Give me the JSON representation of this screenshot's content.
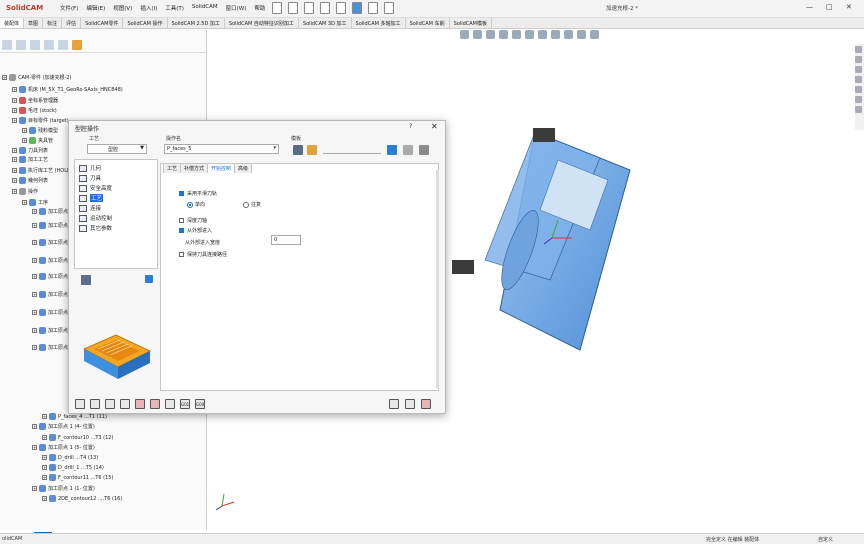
{
  "app": {
    "logo": "SolidCAM",
    "menus": [
      "文件(F)",
      "编辑(E)",
      "视图(V)",
      "插入(I)",
      "工具(T)",
      "SolidCAM",
      "窗口(W)",
      "帮助"
    ],
    "window_title": "加速充根-2 *"
  },
  "tabs": [
    "装配体",
    "草图",
    "标注",
    "评估",
    "SolidCAM零件",
    "SolidCAM 操作",
    "SolidCAM 2.5D 加工",
    "SolidCAM 自动特征识别加工",
    "SolidCAM 3D 加工",
    "SolidCAM 多轴加工",
    "SolidCAM 车削",
    "SolidCAM模板"
  ],
  "tree": {
    "items": [
      {
        "text": "CAM-零件 (加速充根-2)",
        "indent": 0,
        "icon": "gray"
      },
      {
        "text": "机床 (M_5X_T1_GeoRo SAxis_HNC848)",
        "indent": 1,
        "icon": "blue"
      },
      {
        "text": "坐标系管理器",
        "indent": 1,
        "icon": "red"
      },
      {
        "text": "毛坯 (stock)",
        "indent": 1,
        "icon": "red"
      },
      {
        "text": "目标零件 (target)",
        "indent": 1,
        "icon": "blue"
      },
      {
        "text": "残料模型",
        "indent": 2,
        "icon": "blue"
      },
      {
        "text": "夹具管",
        "indent": 2,
        "icon": "green"
      },
      {
        "text": "刀具列表",
        "indent": 1,
        "icon": "blue"
      },
      {
        "text": "加工工艺",
        "indent": 1,
        "icon": "blue"
      },
      {
        "text": "执行库工艺 (HOLE",
        "indent": 1,
        "icon": "blue"
      },
      {
        "text": "幾何列表",
        "indent": 1,
        "icon": "blue"
      },
      {
        "text": "操作",
        "indent": 1,
        "icon": "gray"
      },
      {
        "text": "工序",
        "indent": 2,
        "icon": "blue"
      },
      {
        "text": "加工原点",
        "indent": 3,
        "icon": "blue"
      },
      {
        "text": "加工原点",
        "indent": 3,
        "icon": "blue"
      },
      {
        "text": "加工原点",
        "indent": 3,
        "icon": "blue"
      },
      {
        "text": "加工原点",
        "indent": 3,
        "icon": "blue"
      },
      {
        "text": "加工原点",
        "indent": 3,
        "icon": "blue"
      },
      {
        "text": "加工原点",
        "indent": 3,
        "icon": "blue"
      },
      {
        "text": "加工原点",
        "indent": 3,
        "icon": "blue"
      },
      {
        "text": "加工原点",
        "indent": 3,
        "icon": "blue"
      },
      {
        "text": "加工原点",
        "indent": 3,
        "icon": "blue"
      },
      {
        "text": "P_faces_4 ...T1 (11)",
        "indent": 4,
        "icon": "blue"
      },
      {
        "text": "加工原点 1 (4- 位置)",
        "indent": 3,
        "icon": "blue"
      },
      {
        "text": "F_contour10 ...T3 (12)",
        "indent": 4,
        "icon": "blue"
      },
      {
        "text": "加工原点 1 (5- 位置)",
        "indent": 3,
        "icon": "blue"
      },
      {
        "text": "D_drill ...T4 (13)",
        "indent": 4,
        "icon": "blue"
      },
      {
        "text": "D_drill_1 ...T5 (14)",
        "indent": 4,
        "icon": "blue"
      },
      {
        "text": "F_contour11 ...T6 (15)",
        "indent": 4,
        "icon": "blue"
      },
      {
        "text": "加工原点 1 (1- 位置)",
        "indent": 3,
        "icon": "blue"
      },
      {
        "text": "2DE_contour12 ....T6 (16)",
        "indent": 4,
        "icon": "blue"
      }
    ]
  },
  "dialog": {
    "title": "型腔操作",
    "help": "?",
    "close": "✕",
    "process_label": "工艺",
    "process_value": "型腔",
    "opname_label": "操作名",
    "opname_value": "P_faces_5",
    "template_label": "模板",
    "nav": [
      "几何",
      "刀具",
      "安全高度",
      "工艺",
      "连接",
      "运动控制",
      "其它参数"
    ],
    "nav_selected": 3,
    "content_tabs": [
      "工艺",
      "补偿方式",
      "开始控制",
      "高级"
    ],
    "content_tab_active": 2,
    "options": {
      "smooth_path": "采用平滑刀轨",
      "direction_a": "单向",
      "direction_b": "往复",
      "deep_step": "深度刀轴",
      "from_outside": "从外部进入",
      "outside_count_label": "从外部进入宽度",
      "outside_count_value": "0",
      "keep_path": "保持刀具连接路径"
    }
  },
  "statusbar": {
    "left": "olidCAM",
    "mid": "完全定义 在编辑 装配体",
    "right": "自定义"
  }
}
